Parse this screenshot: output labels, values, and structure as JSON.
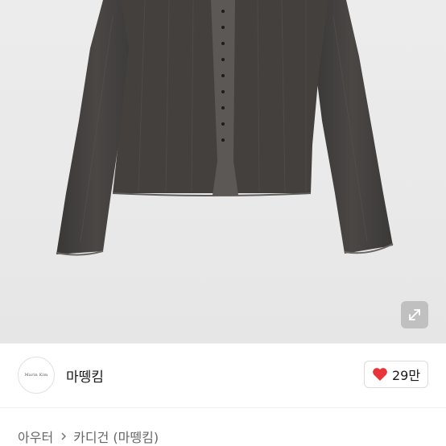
{
  "product_image": {
    "alt": "",
    "expand_icon": "expand-arrows-icon"
  },
  "seller": {
    "avatar_text": "Marin  Kim",
    "name": "마뗑킴",
    "like_icon": "heart-icon",
    "like_count": "29만",
    "like_color": "#e8343a"
  },
  "breadcrumb": {
    "items": [
      "아우터",
      "카디건 (마뗑킴)"
    ],
    "separator_icon": "chevron-right-icon"
  }
}
